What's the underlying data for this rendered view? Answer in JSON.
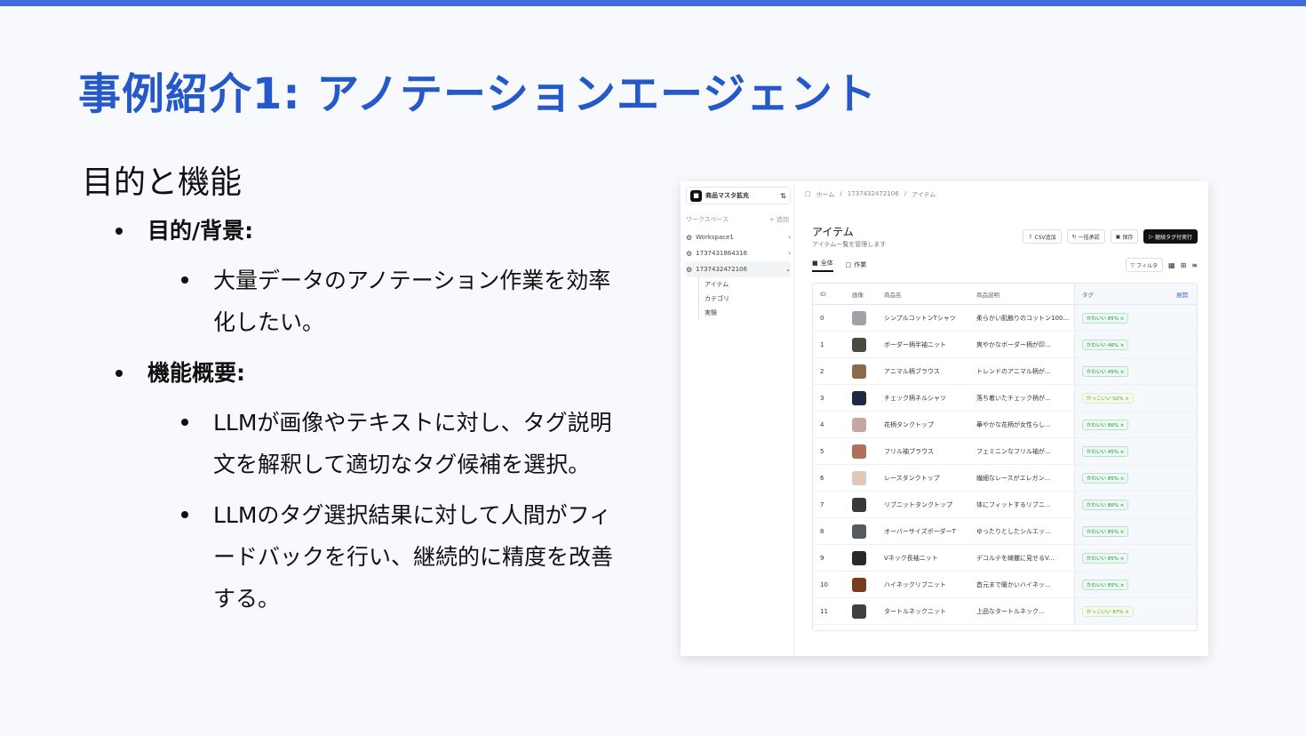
{
  "slide": {
    "title": "事例紹介1: アノテーションエージェント",
    "section": "目的と機能",
    "bullets": [
      {
        "heading": "目的/背景:",
        "items": [
          "大量データのアノテーション作業を効率化したい。"
        ]
      },
      {
        "heading": "機能概要:",
        "items": [
          "LLMが画像やテキストに対し、タグ説明文を解釈して適切なタグ候補を選択。",
          "LLMのタグ選択結果に対して人間がフィードバックを行い、継続的に精度を改善する。"
        ]
      }
    ]
  },
  "colors": {
    "accent": "#2559c9",
    "topbar": "#4169e1",
    "tag_green": "#2a8a4a"
  },
  "app": {
    "org_name": "商品マスタ拡充",
    "workspace_header": "ワークスペース",
    "add_label": "+ 追加",
    "nav": [
      {
        "label": "Workspace1",
        "icon": "workspace-icon"
      },
      {
        "label": "1737431864316",
        "icon": "workspace-icon"
      },
      {
        "label": "1737432472106",
        "icon": "workspace-icon"
      }
    ],
    "subnav": [
      "アイテム",
      "カテゴリ",
      "実験"
    ],
    "breadcrumb": [
      "ホーム",
      "1737432472106",
      "アイテム"
    ],
    "page_title": "アイテム",
    "page_desc": "アイテム一覧を管理します",
    "actions": [
      "CSV追加",
      "一括承認",
      "保存",
      "継続タグ付実行"
    ],
    "tabs": [
      "全体",
      "作業"
    ],
    "filter_label": "フィルタ",
    "columns": [
      "ID",
      "画像",
      "商品名",
      "商品説明",
      "タグ"
    ],
    "more_label": "展開",
    "rows": [
      {
        "id": "0",
        "name": "シンプルコットンTシャツ",
        "desc": "柔らかい肌触りのコットン100...",
        "tag": "かわいい 85%",
        "thumb": "#9ea3a8"
      },
      {
        "id": "1",
        "name": "ボーダー柄半袖ニット",
        "desc": "爽やかなボーダー柄が印...",
        "tag": "かわいい 46%",
        "thumb": "#4a4a3e"
      },
      {
        "id": "2",
        "name": "アニマル柄ブラウス",
        "desc": "トレンドのアニマル柄が...",
        "tag": "かわいい 45%",
        "thumb": "#8a6a4a"
      },
      {
        "id": "3",
        "name": "チェック柄ネルシャツ",
        "desc": "落ち着いたチェック柄が...",
        "tag": "かっこいい 92%",
        "thumb": "#1e2a44"
      },
      {
        "id": "4",
        "name": "花柄タンクトップ",
        "desc": "華やかな花柄が女性らし...",
        "tag": "かわいい 86%",
        "thumb": "#c8a6a0"
      },
      {
        "id": "5",
        "name": "フリル袖ブラウス",
        "desc": "フェミニンなフリル袖が...",
        "tag": "かわいい 45%",
        "thumb": "#b0705a"
      },
      {
        "id": "6",
        "name": "レースタンクトップ",
        "desc": "繊細なレースがエレガン...",
        "tag": "かわいい 85%",
        "thumb": "#e0c8b8"
      },
      {
        "id": "7",
        "name": "リブニットタンクトップ",
        "desc": "体にフィットするリブニ...",
        "tag": "かわいい 86%",
        "thumb": "#3a3a3a"
      },
      {
        "id": "8",
        "name": "オーバーサイズボーダーT",
        "desc": "ゆったりとしたシルエッ...",
        "tag": "かわいい 85%",
        "thumb": "#555a5e"
      },
      {
        "id": "9",
        "name": "Vネック長袖ニット",
        "desc": "デコルテを綺麗に見せるV...",
        "tag": "かわいい 85%",
        "thumb": "#2a2a2a"
      },
      {
        "id": "10",
        "name": "ハイネックリブニット",
        "desc": "首元まで暖かいハイネッ...",
        "tag": "かわいい 85%",
        "thumb": "#7a3a1e"
      },
      {
        "id": "11",
        "name": "タートルネックニット",
        "desc": "上品なタートルネック...",
        "tag": "かっこいい 87%",
        "thumb": "#3e4044"
      }
    ]
  }
}
